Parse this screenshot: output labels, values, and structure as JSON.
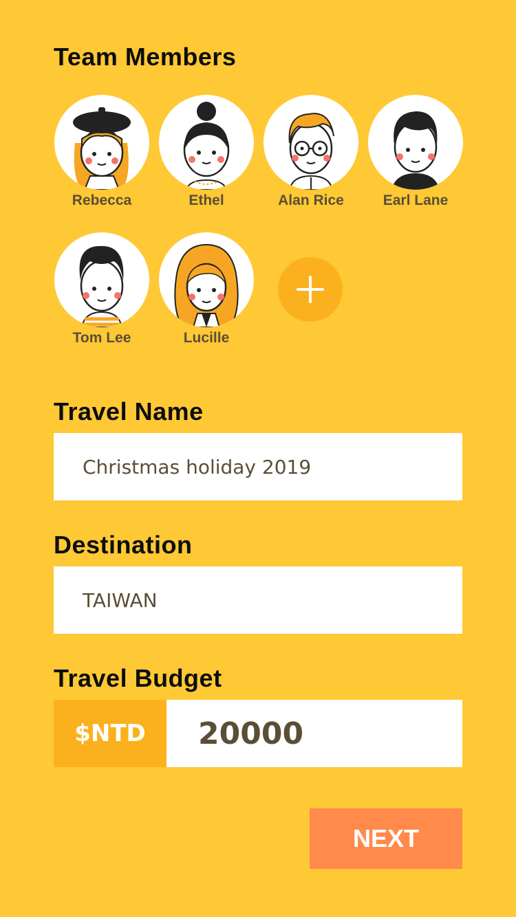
{
  "team": {
    "title": "Team Members",
    "members": [
      {
        "name": "Rebecca",
        "icon": "avatar-girl-beret-icon"
      },
      {
        "name": "Ethel",
        "icon": "avatar-girl-bun-icon"
      },
      {
        "name": "Alan Rice",
        "icon": "avatar-boy-glasses-icon"
      },
      {
        "name": "Earl Lane",
        "icon": "avatar-boy-black-shirt-icon"
      },
      {
        "name": "Tom Lee",
        "icon": "avatar-boy-striped-shirt-icon"
      },
      {
        "name": "Lucille",
        "icon": "avatar-girl-curly-hair-icon"
      }
    ],
    "add_icon": "plus-icon"
  },
  "travel_name": {
    "label": "Travel Name",
    "value": "Christmas holiday 2019"
  },
  "destination": {
    "label": "Destination",
    "value": "TAIWAN"
  },
  "budget": {
    "label": "Travel Budget",
    "currency": "$NTD",
    "value": "20000"
  },
  "next_label": "NEXT",
  "colors": {
    "background": "#FFC835",
    "accent": "#FBB11D",
    "next_button": "#FF8A4C",
    "text_dark": "#0d0d0d",
    "text_brown": "#5b4e36"
  }
}
